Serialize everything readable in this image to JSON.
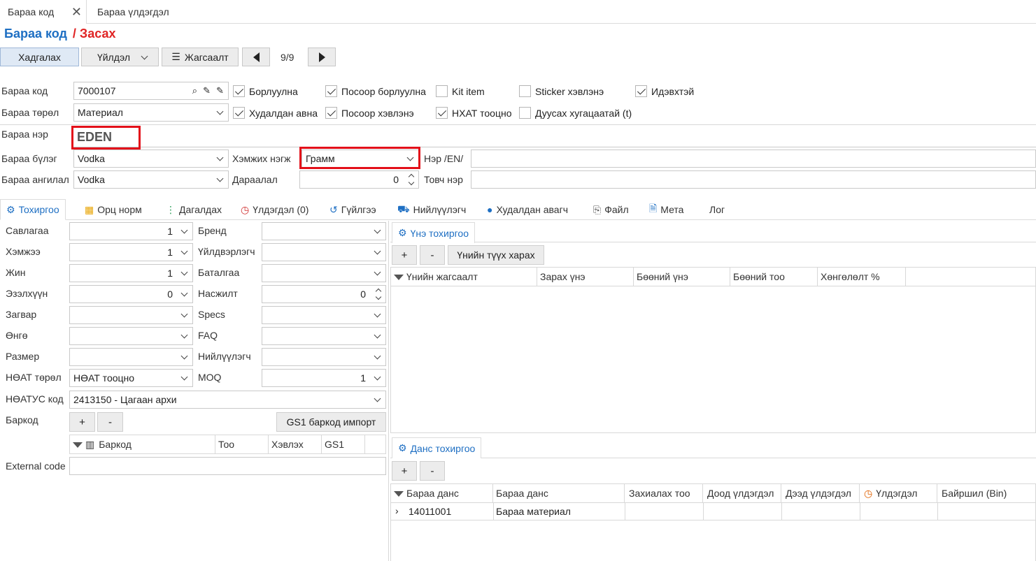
{
  "tabs": [
    {
      "label": "Бараа код"
    },
    {
      "label": "Бараа үлдэгдэл"
    }
  ],
  "breadcrumb": {
    "root": "Бараа код",
    "current": "/ Засах"
  },
  "toolbar": {
    "save": "Хадгалах",
    "actions": "Үйлдэл",
    "list": "Жагсаалт",
    "pager": "9/9"
  },
  "form": {
    "code_label": "Бараа код",
    "code_value": "7000107",
    "type_label": "Бараа төрөл",
    "type_value": "Материал",
    "name_label": "Бараа нэр",
    "name_value": "EDEN",
    "group_label": "Бараа бүлэг",
    "group_value": "Vodka",
    "unit_label": "Хэмжих нэгж",
    "unit_value": "Грамм",
    "name_en_label": "Нэр /EN/",
    "name_en_value": "",
    "class_label": "Бараа ангилал",
    "class_value": "Vodka",
    "order_label": "Дараалал",
    "order_value": "0",
    "short_label": "Товч нэр",
    "short_value": ""
  },
  "checks": [
    {
      "label": "Борлуулна",
      "checked": true
    },
    {
      "label": "Посоор борлуулна",
      "checked": true
    },
    {
      "label": "Kit item",
      "checked": false
    },
    {
      "label": "Sticker хэвлэнэ",
      "checked": false
    },
    {
      "label": "Идэвхтэй",
      "checked": true
    },
    {
      "label": "Худалдан авна",
      "checked": true
    },
    {
      "label": "Посоор хэвлэнэ",
      "checked": true
    },
    {
      "label": "НХАТ тооцно",
      "checked": true
    },
    {
      "label": "Дуусах хугацаатай (t)",
      "checked": false
    }
  ],
  "panel_tabs": [
    {
      "label": "Тохиргоо",
      "icon": "gear-icon"
    },
    {
      "label": "Орц норм",
      "icon": "grid-icon"
    },
    {
      "label": "Дагалдах",
      "icon": "tree-icon"
    },
    {
      "label": "Үлдэгдэл (0)",
      "icon": "clock-icon"
    },
    {
      "label": "Гүйлгээ",
      "icon": "history-icon"
    },
    {
      "label": "Нийлүүлэгч",
      "icon": "truck-icon"
    },
    {
      "label": "Худалдан авагч",
      "icon": "person-icon"
    },
    {
      "label": "Файл",
      "icon": "paperclip-icon"
    },
    {
      "label": "Мета",
      "icon": "doc-gear-icon"
    },
    {
      "label": "Лог",
      "icon": ""
    }
  ],
  "settings": {
    "left": [
      {
        "label": "Савлагаа",
        "value": "1"
      },
      {
        "label": "Хэмжээ",
        "value": "1"
      },
      {
        "label": "Жин",
        "value": "1"
      },
      {
        "label": "Эзэлхүүн",
        "value": "0"
      },
      {
        "label": "Загвар",
        "value": ""
      },
      {
        "label": "Өнгө",
        "value": ""
      },
      {
        "label": "Размер",
        "value": ""
      },
      {
        "label": "НӨАТ төрөл",
        "value": "НӨАТ тооцно"
      }
    ],
    "right": [
      {
        "label": "Бренд",
        "value": ""
      },
      {
        "label": "Үйлдвэрлэгч",
        "value": ""
      },
      {
        "label": "Баталгаа",
        "value": ""
      },
      {
        "label": "Насжилт",
        "value": "0"
      },
      {
        "label": "Specs",
        "value": ""
      },
      {
        "label": "FAQ",
        "value": ""
      },
      {
        "label": "Нийлүүлэгч",
        "value": ""
      },
      {
        "label": "MOQ",
        "value": "1"
      }
    ],
    "vat_code_label": "НӨАТУС код",
    "vat_code_value": "2413150 - Цагаан архи",
    "barcode_label": "Баркод",
    "gs1_import": "GS1 баркод импорт",
    "barcode_cols": [
      "Баркод",
      "Тоо",
      "Хэвлэх",
      "GS1"
    ],
    "external_label": "External code",
    "external_value": ""
  },
  "price": {
    "tab": "Үнэ тохиргоо",
    "history_button": "Үнийн түүх харах",
    "add": "+",
    "remove": "-",
    "cols": [
      "Үнийн жагсаалт",
      "Зарах үнэ",
      "Бөөний үнэ",
      "Бөөний тоо",
      "Хөнгөлөлт %"
    ]
  },
  "account": {
    "tab": "Данс тохиргоо",
    "add": "+",
    "remove": "-",
    "cols": [
      "Бараа данс",
      "Бараа данс",
      "Захиалах тоо",
      "Доод үлдэгдэл",
      "Дээд үлдэгдэл",
      "Үлдэгдэл",
      "Байршил (Bin)"
    ],
    "rows": [
      {
        "code": "14011001",
        "name": "Бараа материал"
      }
    ]
  },
  "colors": {
    "accent": "#1e6fc3",
    "edit_red": "#e02424",
    "highlight": "#e3101a"
  }
}
